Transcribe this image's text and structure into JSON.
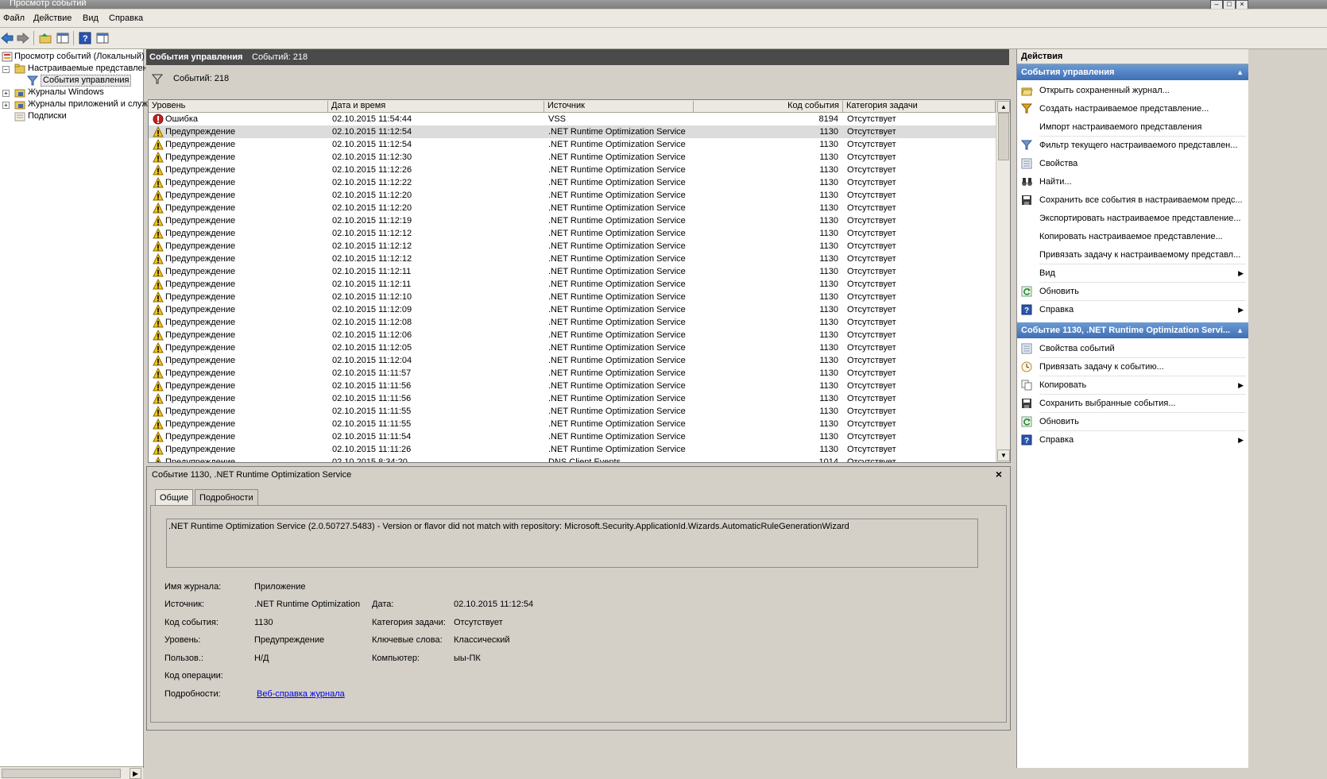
{
  "window": {
    "title": "Просмотр событий"
  },
  "menu": [
    "Файл",
    "Действие",
    "Вид",
    "Справка"
  ],
  "tree": {
    "root": "Просмотр событий (Локальный)",
    "custom_views": "Настраиваемые представлени",
    "admin_events": "События управления",
    "windows_logs": "Журналы Windows",
    "app_logs": "Журналы приложений и служ",
    "subscriptions": "Подписки"
  },
  "center": {
    "title": "События управления",
    "count": "Событий: 218",
    "filter_count": "Событий: 218",
    "columns": [
      "Уровень",
      "Дата и время",
      "Источник",
      "Код события",
      "Категория задачи"
    ],
    "rows": [
      {
        "level": "Ошибка",
        "type": "error",
        "date": "02.10.2015 11:54:44",
        "source": "VSS",
        "code": "8194",
        "cat": "Отсутствует"
      },
      {
        "level": "Предупреждение",
        "type": "warn",
        "date": "02.10.2015 11:12:54",
        "source": ".NET Runtime Optimization Service",
        "code": "1130",
        "cat": "Отсутствует"
      },
      {
        "level": "Предупреждение",
        "type": "warn",
        "date": "02.10.2015 11:12:54",
        "source": ".NET Runtime Optimization Service",
        "code": "1130",
        "cat": "Отсутствует"
      },
      {
        "level": "Предупреждение",
        "type": "warn",
        "date": "02.10.2015 11:12:30",
        "source": ".NET Runtime Optimization Service",
        "code": "1130",
        "cat": "Отсутствует"
      },
      {
        "level": "Предупреждение",
        "type": "warn",
        "date": "02.10.2015 11:12:26",
        "source": ".NET Runtime Optimization Service",
        "code": "1130",
        "cat": "Отсутствует"
      },
      {
        "level": "Предупреждение",
        "type": "warn",
        "date": "02.10.2015 11:12:22",
        "source": ".NET Runtime Optimization Service",
        "code": "1130",
        "cat": "Отсутствует"
      },
      {
        "level": "Предупреждение",
        "type": "warn",
        "date": "02.10.2015 11:12:20",
        "source": ".NET Runtime Optimization Service",
        "code": "1130",
        "cat": "Отсутствует"
      },
      {
        "level": "Предупреждение",
        "type": "warn",
        "date": "02.10.2015 11:12:20",
        "source": ".NET Runtime Optimization Service",
        "code": "1130",
        "cat": "Отсутствует"
      },
      {
        "level": "Предупреждение",
        "type": "warn",
        "date": "02.10.2015 11:12:19",
        "source": ".NET Runtime Optimization Service",
        "code": "1130",
        "cat": "Отсутствует"
      },
      {
        "level": "Предупреждение",
        "type": "warn",
        "date": "02.10.2015 11:12:12",
        "source": ".NET Runtime Optimization Service",
        "code": "1130",
        "cat": "Отсутствует"
      },
      {
        "level": "Предупреждение",
        "type": "warn",
        "date": "02.10.2015 11:12:12",
        "source": ".NET Runtime Optimization Service",
        "code": "1130",
        "cat": "Отсутствует"
      },
      {
        "level": "Предупреждение",
        "type": "warn",
        "date": "02.10.2015 11:12:12",
        "source": ".NET Runtime Optimization Service",
        "code": "1130",
        "cat": "Отсутствует"
      },
      {
        "level": "Предупреждение",
        "type": "warn",
        "date": "02.10.2015 11:12:11",
        "source": ".NET Runtime Optimization Service",
        "code": "1130",
        "cat": "Отсутствует"
      },
      {
        "level": "Предупреждение",
        "type": "warn",
        "date": "02.10.2015 11:12:11",
        "source": ".NET Runtime Optimization Service",
        "code": "1130",
        "cat": "Отсутствует"
      },
      {
        "level": "Предупреждение",
        "type": "warn",
        "date": "02.10.2015 11:12:10",
        "source": ".NET Runtime Optimization Service",
        "code": "1130",
        "cat": "Отсутствует"
      },
      {
        "level": "Предупреждение",
        "type": "warn",
        "date": "02.10.2015 11:12:09",
        "source": ".NET Runtime Optimization Service",
        "code": "1130",
        "cat": "Отсутствует"
      },
      {
        "level": "Предупреждение",
        "type": "warn",
        "date": "02.10.2015 11:12:08",
        "source": ".NET Runtime Optimization Service",
        "code": "1130",
        "cat": "Отсутствует"
      },
      {
        "level": "Предупреждение",
        "type": "warn",
        "date": "02.10.2015 11:12:06",
        "source": ".NET Runtime Optimization Service",
        "code": "1130",
        "cat": "Отсутствует"
      },
      {
        "level": "Предупреждение",
        "type": "warn",
        "date": "02.10.2015 11:12:05",
        "source": ".NET Runtime Optimization Service",
        "code": "1130",
        "cat": "Отсутствует"
      },
      {
        "level": "Предупреждение",
        "type": "warn",
        "date": "02.10.2015 11:12:04",
        "source": ".NET Runtime Optimization Service",
        "code": "1130",
        "cat": "Отсутствует"
      },
      {
        "level": "Предупреждение",
        "type": "warn",
        "date": "02.10.2015 11:11:57",
        "source": ".NET Runtime Optimization Service",
        "code": "1130",
        "cat": "Отсутствует"
      },
      {
        "level": "Предупреждение",
        "type": "warn",
        "date": "02.10.2015 11:11:56",
        "source": ".NET Runtime Optimization Service",
        "code": "1130",
        "cat": "Отсутствует"
      },
      {
        "level": "Предупреждение",
        "type": "warn",
        "date": "02.10.2015 11:11:56",
        "source": ".NET Runtime Optimization Service",
        "code": "1130",
        "cat": "Отсутствует"
      },
      {
        "level": "Предупреждение",
        "type": "warn",
        "date": "02.10.2015 11:11:55",
        "source": ".NET Runtime Optimization Service",
        "code": "1130",
        "cat": "Отсутствует"
      },
      {
        "level": "Предупреждение",
        "type": "warn",
        "date": "02.10.2015 11:11:55",
        "source": ".NET Runtime Optimization Service",
        "code": "1130",
        "cat": "Отсутствует"
      },
      {
        "level": "Предупреждение",
        "type": "warn",
        "date": "02.10.2015 11:11:54",
        "source": ".NET Runtime Optimization Service",
        "code": "1130",
        "cat": "Отсутствует"
      },
      {
        "level": "Предупреждение",
        "type": "warn",
        "date": "02.10.2015 11:11:26",
        "source": ".NET Runtime Optimization Service",
        "code": "1130",
        "cat": "Отсутствует"
      },
      {
        "level": "Предупреждение",
        "type": "warn",
        "date": "02.10.2015 8:34:20",
        "source": "DNS Client Events",
        "code": "1014",
        "cat": "Отсутствует"
      }
    ]
  },
  "details": {
    "title": "Событие 1130, .NET Runtime Optimization Service",
    "tab_general": "Общие",
    "tab_details": "Подробности",
    "message": ".NET Runtime Optimization Service (2.0.50727.5483) - Version or flavor did not match with repository: Microsoft.Security.ApplicationId.Wizards.AutomaticRuleGenerationWizard",
    "log_name_label": "Имя журнала:",
    "log_name": "Приложение",
    "source_label": "Источник:",
    "source": ".NET Runtime Optimization",
    "date_label": "Дата:",
    "date": "02.10.2015 11:12:54",
    "code_label": "Код события:",
    "code": "1130",
    "task_label": "Категория задачи:",
    "task": "Отсутствует",
    "level_label": "Уровень:",
    "level": "Предупреждение",
    "keywords_label": "Ключевые слова:",
    "keywords": "Классический",
    "user_label": "Пользов.:",
    "user": "Н/Д",
    "computer_label": "Компьютер:",
    "computer": "ыы-ПК",
    "opcode_label": "Код операции:",
    "more_label": "Подробности:",
    "more_link": "Веб-справка журнала"
  },
  "actions": {
    "header": "Действия",
    "section1": "События управления",
    "items1": [
      {
        "label": "Открыть сохраненный журнал...",
        "icon": "open-folder-icon"
      },
      {
        "label": "Создать настраиваемое представление...",
        "icon": "filter-create-icon"
      },
      {
        "label": "Импорт настраиваемого представления",
        "icon": ""
      },
      {
        "label": "Фильтр текущего настраиваемого представлен...",
        "icon": "filter-icon"
      },
      {
        "label": "Свойства",
        "icon": "properties-icon"
      },
      {
        "label": "Найти...",
        "icon": "binoculars-icon"
      },
      {
        "label": "Сохранить все события в настраиваемом предс...",
        "icon": "save-icon"
      },
      {
        "label": "Экспортировать настраиваемое представление...",
        "icon": ""
      },
      {
        "label": "Копировать настраиваемое представление...",
        "icon": ""
      },
      {
        "label": "Привязать задачу к настраиваемому представл...",
        "icon": ""
      },
      {
        "label": "Вид",
        "icon": "",
        "submenu": true
      },
      {
        "label": "Обновить",
        "icon": "refresh-icon"
      },
      {
        "label": "Справка",
        "icon": "help-icon",
        "submenu": true
      }
    ],
    "section2": "Событие 1130, .NET Runtime Optimization Servi...",
    "items2": [
      {
        "label": "Свойства событий",
        "icon": "properties-icon"
      },
      {
        "label": "Привязать задачу к событию...",
        "icon": "task-icon"
      },
      {
        "label": "Копировать",
        "icon": "copy-icon",
        "submenu": true
      },
      {
        "label": "Сохранить выбранные события...",
        "icon": "save-icon"
      },
      {
        "label": "Обновить",
        "icon": "refresh-icon"
      },
      {
        "label": "Справка",
        "icon": "help-icon",
        "submenu": true
      }
    ]
  }
}
